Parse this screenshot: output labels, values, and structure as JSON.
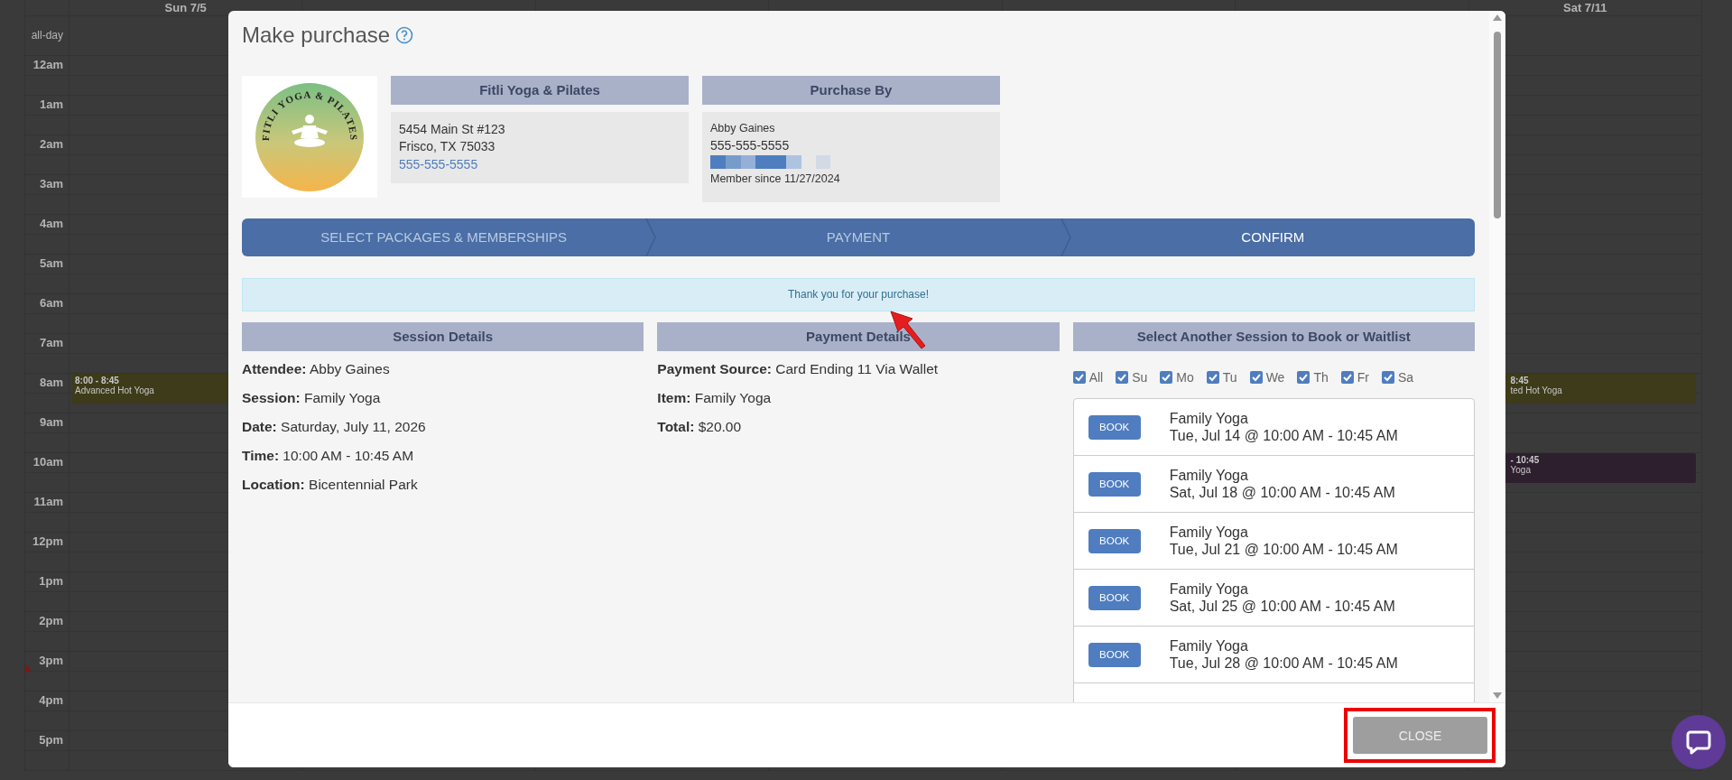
{
  "calendar": {
    "days": [
      {
        "label": "Sun 7/5",
        "kind": "first"
      },
      {
        "label": "Sat 7/11",
        "kind": "last"
      }
    ],
    "all_day_label": "all-day",
    "hours": [
      {
        "label": "12am"
      },
      {
        "label": "1am"
      },
      {
        "label": "2am"
      },
      {
        "label": "3am"
      },
      {
        "label": "4am"
      },
      {
        "label": "5am"
      },
      {
        "label": "6am"
      },
      {
        "label": "7am"
      },
      {
        "label": "8am",
        "first_event": {
          "time": "8:00 - 8:45",
          "title": "Advanced Hot Yoga",
          "color": "#3d3b19"
        },
        "last_event": {
          "time": "8:45",
          "title": "ted Hot Yoga",
          "color": "#3d3b19"
        }
      },
      {
        "label": "9am"
      },
      {
        "label": "10am",
        "last_event": {
          "time": "- 10:45",
          "title": "Yoga",
          "color": "#2e1f2e"
        }
      },
      {
        "label": "11am"
      },
      {
        "label": "12pm"
      },
      {
        "label": "1pm"
      },
      {
        "label": "2pm"
      },
      {
        "label": "3pm"
      },
      {
        "label": "4pm"
      },
      {
        "label": "5pm"
      }
    ]
  },
  "dialog": {
    "title": "Make purchase",
    "studio": {
      "heading": "Fitli Yoga & Pilates",
      "logo_text": "FITLI YOGA & PILATES",
      "address_lines": [
        "5454 Main St #123",
        "Frisco, TX 75033"
      ],
      "phone": "555-555-5555"
    },
    "purchaser": {
      "heading": "Purchase By",
      "name": "Abby Gaines",
      "phone": "555-555-5555",
      "member_since": "Member since 11/27/2024"
    },
    "steps": [
      {
        "label": "SELECT PACKAGES & MEMBERSHIPS",
        "selected": false
      },
      {
        "label": "PAYMENT",
        "selected": false
      },
      {
        "label": "CONFIRM",
        "selected": true
      }
    ],
    "alert": "Thank you for your purchase!",
    "session_details": {
      "heading": "Session Details",
      "lines": [
        "**Attendee:** Abby Gaines",
        "**Session:** Family Yoga",
        "**Date:** Saturday, July 11, 2026",
        "**Time:** 10:00 AM - 10:45 AM",
        "**Location:** Bicentennial Park"
      ]
    },
    "payment_details": {
      "heading": "Payment Details",
      "lines": [
        "**Payment Source:** Card Ending 11 Via Wallet",
        "**Item:** Family Yoga",
        "**Total:** $20.00"
      ]
    },
    "other_sessions": {
      "heading": "Select Another Session to Book or Waitlist",
      "day_filters": [
        {
          "label": "All",
          "checked": true
        },
        {
          "label": "Su",
          "checked": true
        },
        {
          "label": "Mo",
          "checked": true
        },
        {
          "label": "Tu",
          "checked": true
        },
        {
          "label": "We",
          "checked": true
        },
        {
          "label": "Th",
          "checked": true
        },
        {
          "label": "Fr",
          "checked": true
        },
        {
          "label": "Sa",
          "checked": true
        }
      ],
      "sessions": [
        {
          "button": "BOOK",
          "name": "Family Yoga",
          "when": "Tue, Jul 14 @ 10:00 AM - 10:45 AM"
        },
        {
          "button": "BOOK",
          "name": "Family Yoga",
          "when": "Sat, Jul 18 @ 10:00 AM - 10:45 AM"
        },
        {
          "button": "BOOK",
          "name": "Family Yoga",
          "when": "Tue, Jul 21 @ 10:00 AM - 10:45 AM"
        },
        {
          "button": "BOOK",
          "name": "Family Yoga",
          "when": "Sat, Jul 25 @ 10:00 AM - 10:45 AM"
        },
        {
          "button": "BOOK",
          "name": "Family Yoga",
          "when": "Tue, Jul 28 @ 10:00 AM - 10:45 AM"
        }
      ]
    },
    "close_button": "CLOSE"
  }
}
